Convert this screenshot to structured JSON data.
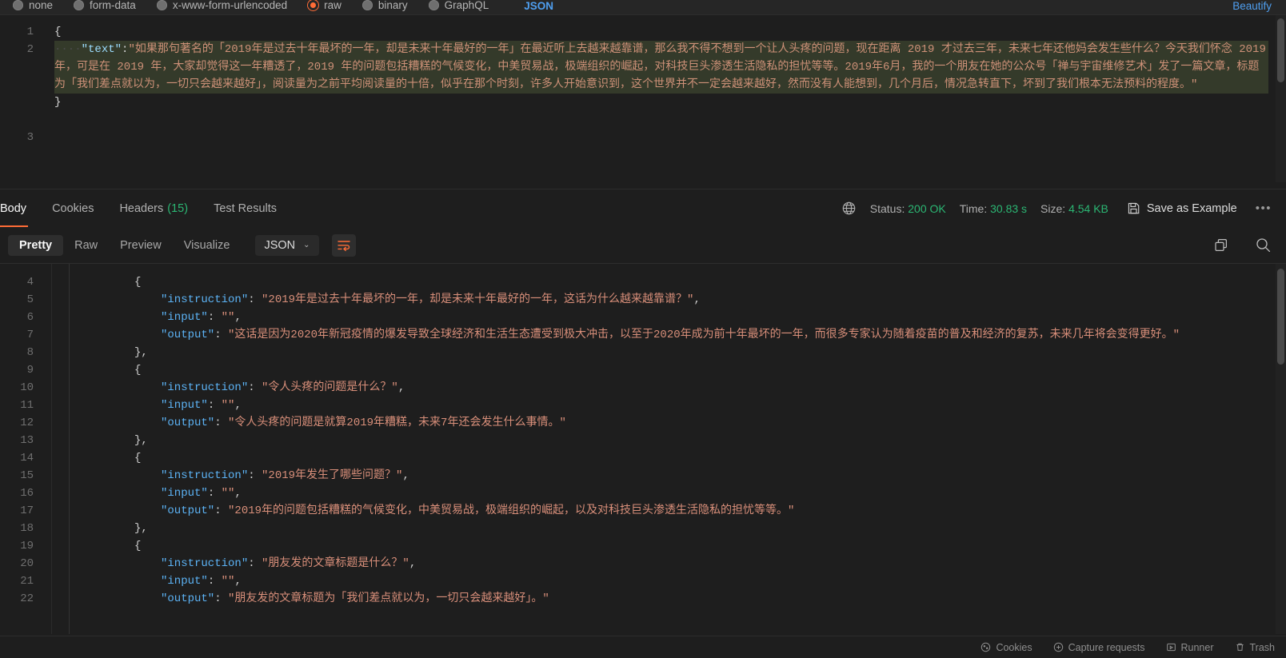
{
  "request_body_type": {
    "options": [
      {
        "label": "none",
        "selected": false
      },
      {
        "label": "form-data",
        "selected": false
      },
      {
        "label": "x-www-form-urlencoded",
        "selected": false
      },
      {
        "label": "raw",
        "selected": true
      },
      {
        "label": "binary",
        "selected": false
      },
      {
        "label": "GraphQL",
        "selected": false
      }
    ],
    "language": "JSON",
    "beautify_label": "Beautify"
  },
  "request_editor": {
    "line_numbers": [
      "1",
      "2",
      "3"
    ],
    "open_brace": "{",
    "close_brace": "}",
    "indent": "····",
    "key": "\"text\"",
    "colon": ":",
    "value": "\"如果那句著名的「2019年是过去十年最坏的一年，却是未来十年最好的一年」在最近听上去越来越靠谱，那么我不得不想到一个让人头疼的问题，现在距离 2019 才过去三年，未来七年还他妈会发生些什么？今天我们怀念 2019 年，可是在 2019 年，大家却觉得这一年糟透了，2019 年的问题包括糟糕的气候变化，中美贸易战，极端组织的崛起，对科技巨头渗透生活隐私的担忧等等。2019年6月，我的一个朋友在她的公众号「禅与宇宙维修艺术」发了一篇文章，标题为「我们差点就以为，一切只会越来越好」，阅读量为之前平均阅读量的十倍，似乎在那个时刻，许多人开始意识到，这个世界并不一定会越来越好，然而没有人能想到，几个月后，情况急转直下，坏到了我们根本无法预料的程度。\""
  },
  "response_tabs": [
    {
      "label": "Body",
      "count": "",
      "active": true
    },
    {
      "label": "Cookies",
      "count": "",
      "active": false
    },
    {
      "label": "Headers",
      "count": "(15)",
      "active": false
    },
    {
      "label": "Test Results",
      "count": "",
      "active": false
    }
  ],
  "response_meta": {
    "status_label": "Status:",
    "status_value": "200 OK",
    "time_label": "Time:",
    "time_value": "30.83 s",
    "size_label": "Size:",
    "size_value": "4.54 KB",
    "save_as_example": "Save as Example",
    "more_menu": "•••"
  },
  "response_toolbar": {
    "view_tabs": [
      {
        "label": "Pretty",
        "active": true
      },
      {
        "label": "Raw",
        "active": false
      },
      {
        "label": "Preview",
        "active": false
      },
      {
        "label": "Visualize",
        "active": false
      }
    ],
    "format": "JSON",
    "chevron": "⌄"
  },
  "response_body": {
    "lines": [
      {
        "num": "4",
        "indent": 2,
        "parts": [
          {
            "t": "punc",
            "v": "{"
          }
        ]
      },
      {
        "num": "5",
        "indent": 3,
        "parts": [
          {
            "t": "key",
            "v": "\"instruction\""
          },
          {
            "t": "punc",
            "v": ": "
          },
          {
            "t": "str",
            "v": "\"2019年是过去十年最坏的一年，却是未来十年最好的一年，这话为什么越来越靠谱？\""
          },
          {
            "t": "punc",
            "v": ","
          }
        ]
      },
      {
        "num": "6",
        "indent": 3,
        "parts": [
          {
            "t": "key",
            "v": "\"input\""
          },
          {
            "t": "punc",
            "v": ": "
          },
          {
            "t": "str",
            "v": "\"\""
          },
          {
            "t": "punc",
            "v": ","
          }
        ]
      },
      {
        "num": "7",
        "indent": 3,
        "parts": [
          {
            "t": "key",
            "v": "\"output\""
          },
          {
            "t": "punc",
            "v": ": "
          },
          {
            "t": "str",
            "v": "\"这话是因为2020年新冠疫情的爆发导致全球经济和生活生态遭受到极大冲击，以至于2020年成为前十年最坏的一年，而很多专家认为随着疫苗的普及和经济的复苏，未来几年将会变得更好。\""
          }
        ]
      },
      {
        "num": "8",
        "indent": 2,
        "parts": [
          {
            "t": "punc",
            "v": "},"
          }
        ]
      },
      {
        "num": "9",
        "indent": 2,
        "parts": [
          {
            "t": "punc",
            "v": "{"
          }
        ]
      },
      {
        "num": "10",
        "indent": 3,
        "parts": [
          {
            "t": "key",
            "v": "\"instruction\""
          },
          {
            "t": "punc",
            "v": ": "
          },
          {
            "t": "str",
            "v": "\"令人头疼的问题是什么？\""
          },
          {
            "t": "punc",
            "v": ","
          }
        ]
      },
      {
        "num": "11",
        "indent": 3,
        "parts": [
          {
            "t": "key",
            "v": "\"input\""
          },
          {
            "t": "punc",
            "v": ": "
          },
          {
            "t": "str",
            "v": "\"\""
          },
          {
            "t": "punc",
            "v": ","
          }
        ]
      },
      {
        "num": "12",
        "indent": 3,
        "parts": [
          {
            "t": "key",
            "v": "\"output\""
          },
          {
            "t": "punc",
            "v": ": "
          },
          {
            "t": "str",
            "v": "\"令人头疼的问题是就算2019年糟糕，未来7年还会发生什么事情。\""
          }
        ]
      },
      {
        "num": "13",
        "indent": 2,
        "parts": [
          {
            "t": "punc",
            "v": "},"
          }
        ]
      },
      {
        "num": "14",
        "indent": 2,
        "parts": [
          {
            "t": "punc",
            "v": "{"
          }
        ]
      },
      {
        "num": "15",
        "indent": 3,
        "parts": [
          {
            "t": "key",
            "v": "\"instruction\""
          },
          {
            "t": "punc",
            "v": ": "
          },
          {
            "t": "str",
            "v": "\"2019年发生了哪些问题？\""
          },
          {
            "t": "punc",
            "v": ","
          }
        ]
      },
      {
        "num": "16",
        "indent": 3,
        "parts": [
          {
            "t": "key",
            "v": "\"input\""
          },
          {
            "t": "punc",
            "v": ": "
          },
          {
            "t": "str",
            "v": "\"\""
          },
          {
            "t": "punc",
            "v": ","
          }
        ]
      },
      {
        "num": "17",
        "indent": 3,
        "parts": [
          {
            "t": "key",
            "v": "\"output\""
          },
          {
            "t": "punc",
            "v": ": "
          },
          {
            "t": "str",
            "v": "\"2019年的问题包括糟糕的气候变化，中美贸易战，极端组织的崛起，以及对科技巨头渗透生活隐私的担忧等等。\""
          }
        ]
      },
      {
        "num": "18",
        "indent": 2,
        "parts": [
          {
            "t": "punc",
            "v": "},"
          }
        ]
      },
      {
        "num": "19",
        "indent": 2,
        "parts": [
          {
            "t": "punc",
            "v": "{"
          }
        ]
      },
      {
        "num": "20",
        "indent": 3,
        "parts": [
          {
            "t": "key",
            "v": "\"instruction\""
          },
          {
            "t": "punc",
            "v": ": "
          },
          {
            "t": "str",
            "v": "\"朋友发的文章标题是什么？\""
          },
          {
            "t": "punc",
            "v": ","
          }
        ]
      },
      {
        "num": "21",
        "indent": 3,
        "parts": [
          {
            "t": "key",
            "v": "\"input\""
          },
          {
            "t": "punc",
            "v": ": "
          },
          {
            "t": "str",
            "v": "\"\""
          },
          {
            "t": "punc",
            "v": ","
          }
        ]
      },
      {
        "num": "22",
        "indent": 3,
        "parts": [
          {
            "t": "key",
            "v": "\"output\""
          },
          {
            "t": "punc",
            "v": ": "
          },
          {
            "t": "str",
            "v": "\"朋友发的文章标题为「我们差点就以为，一切只会越来越好」。\""
          }
        ]
      }
    ]
  },
  "statusbar": {
    "items": [
      "Cookies",
      "Capture requests",
      "Runner",
      "Trash"
    ]
  },
  "colors": {
    "accent": "#ff6c37",
    "success": "#2bb673",
    "link": "#4f9ff0",
    "bg": "#1e1e1e"
  }
}
